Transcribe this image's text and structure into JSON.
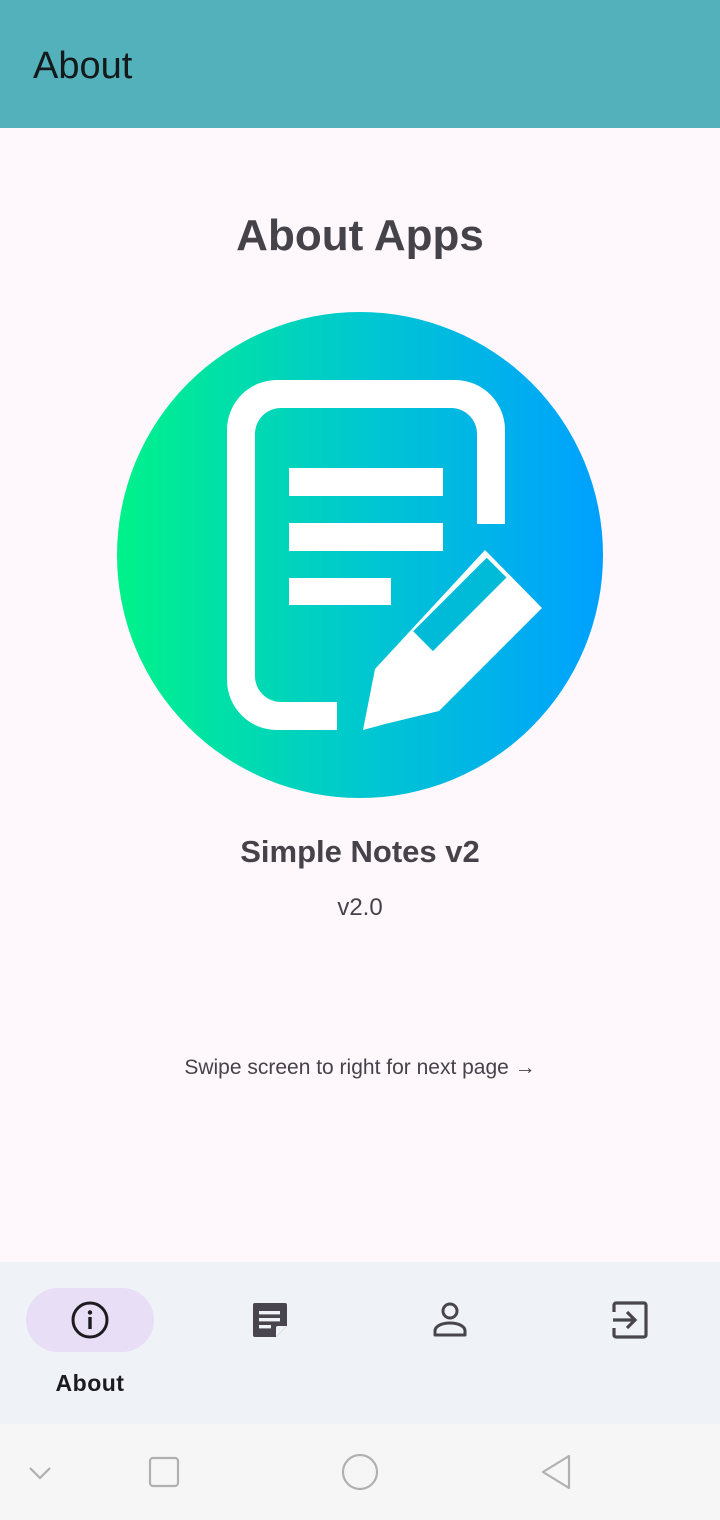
{
  "appbar": {
    "title": "About",
    "background": "#53b1bb"
  },
  "main": {
    "heading": "About Apps",
    "logo": {
      "icon": "note-edit-icon",
      "gradient": [
        "#00f28a",
        "#00c8cf",
        "#00a0ff"
      ]
    },
    "app_name": "Simple Notes v2",
    "version": "v2.0",
    "swipe_hint": "Swipe screen to right for next page →"
  },
  "bottom_nav": {
    "items": [
      {
        "label": "About",
        "icon": "info-icon",
        "selected": true
      },
      {
        "label": "",
        "icon": "notes-icon",
        "selected": false
      },
      {
        "label": "",
        "icon": "profile-icon",
        "selected": false
      },
      {
        "label": "",
        "icon": "logout-icon",
        "selected": false
      }
    ],
    "indicator_color": "#e8def6"
  },
  "system_nav": {
    "buttons": [
      "chevron-down-icon",
      "recents-icon",
      "home-icon",
      "back-icon"
    ]
  }
}
